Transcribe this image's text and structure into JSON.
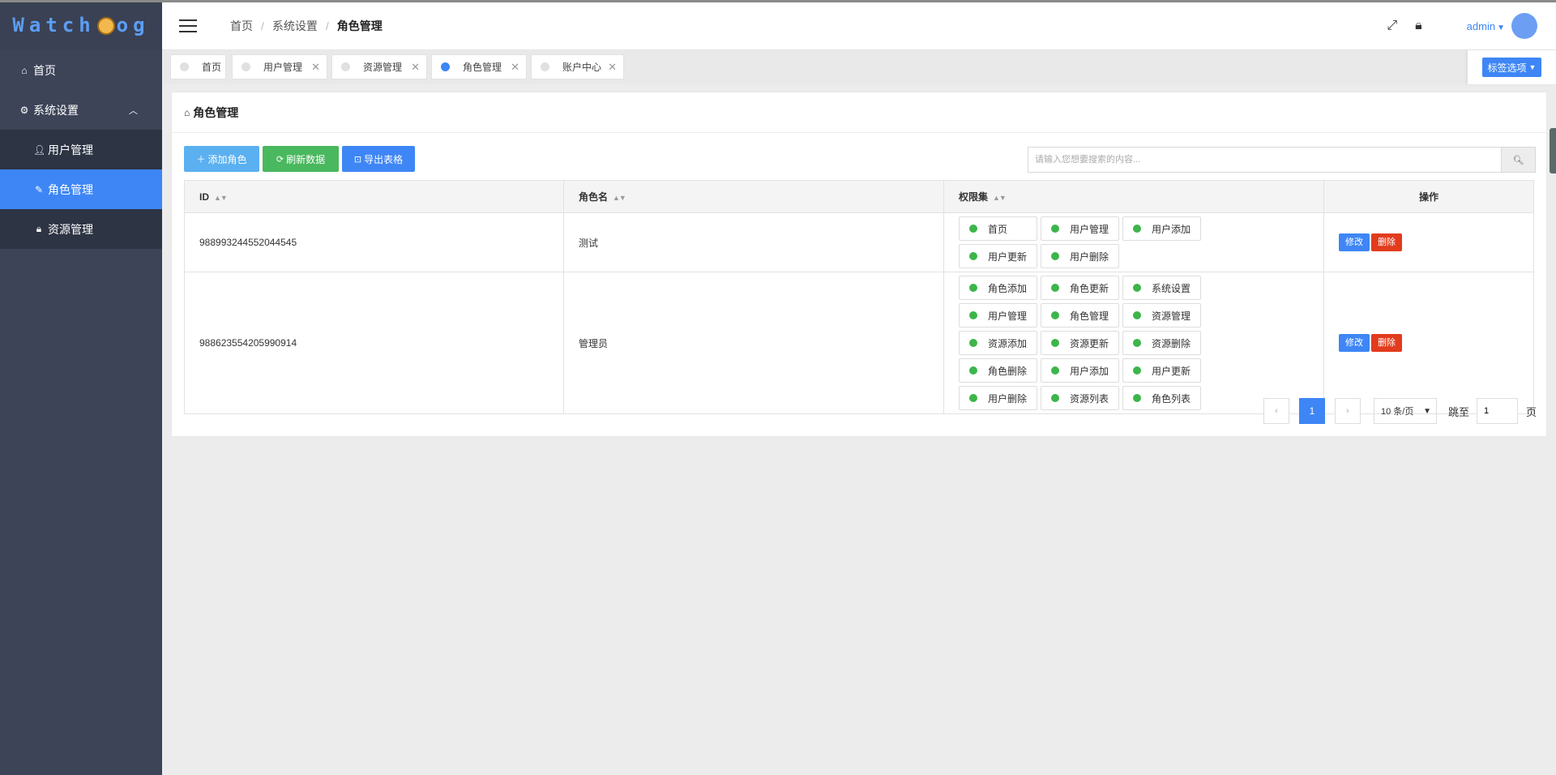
{
  "logo": {
    "left": "Watch",
    "right": "og"
  },
  "sidebar": {
    "home": "首页",
    "system": "系统设置",
    "items": [
      {
        "label": "用户管理",
        "active": false
      },
      {
        "label": "角色管理",
        "active": true
      },
      {
        "label": "资源管理",
        "active": false
      }
    ]
  },
  "header": {
    "breadcrumb": [
      "首页",
      "系统设置",
      "角色管理"
    ],
    "user": "admin"
  },
  "tabs": [
    {
      "label": "首页",
      "closable": false,
      "active": false
    },
    {
      "label": "用户管理",
      "closable": true,
      "active": false
    },
    {
      "label": "资源管理",
      "closable": true,
      "active": false
    },
    {
      "label": "角色管理",
      "closable": true,
      "active": true
    },
    {
      "label": "账户中心",
      "closable": true,
      "active": false
    }
  ],
  "tab_options": "标签选项",
  "card": {
    "title": "角色管理",
    "buttons": {
      "add": "添加角色",
      "refresh": "刷新数据",
      "export": "导出表格"
    },
    "search_placeholder": "请输入您想要搜索的内容..."
  },
  "table": {
    "columns": [
      "ID",
      "角色名",
      "权限集",
      "操作"
    ],
    "rows": [
      {
        "id": "988993244552044545",
        "name": "测试",
        "perms": [
          "首页",
          "用户管理",
          "用户添加",
          "用户更新",
          "用户删除"
        ]
      },
      {
        "id": "988623554205990914",
        "name": "管理员",
        "perms": [
          "角色添加",
          "角色更新",
          "系统设置",
          "用户管理",
          "角色管理",
          "资源管理",
          "资源添加",
          "资源更新",
          "资源删除",
          "角色删除",
          "用户添加",
          "用户更新",
          "用户删除",
          "资源列表",
          "角色列表"
        ]
      }
    ],
    "edit_label": "修改",
    "delete_label": "删除"
  },
  "pager": {
    "current": "1",
    "page_size": "10 条/页",
    "jump_label": "跳至",
    "jump_value": "1",
    "page_label": "页"
  },
  "colors": {
    "accent": "#3e86f5",
    "sidebar": "#3d4458",
    "success": "#49b85e",
    "danger": "#e23b1d"
  }
}
